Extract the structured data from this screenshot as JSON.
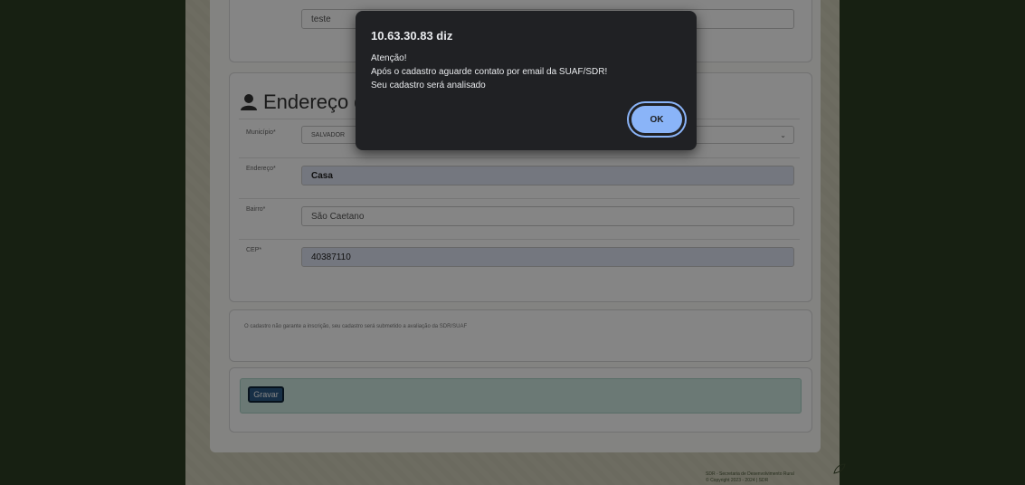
{
  "form": {
    "previous_field_value": "teste",
    "section_title": "Endereço do",
    "municipio": {
      "label": "Município*",
      "value": "SALVADOR"
    },
    "endereco": {
      "label": "Endereço*",
      "value": "Casa"
    },
    "bairro": {
      "label": "Bairro*",
      "value": "São Caetano"
    },
    "cep": {
      "label": "CEP*",
      "value": "40387110"
    },
    "notice": "O cadastro não garante a inscrição, seu cadastro será submetido a avaliação da SDR/SUAF",
    "save_label": "Gravar"
  },
  "footer": {
    "line1": "SDR - Secretaria de Desenvolvimento Rural",
    "line2": "© Copyright 2023 - 2024 | SDR"
  },
  "dialog": {
    "title": "10.63.30.83 diz",
    "message": "Atenção!\nApós o cadastro aguarde contato por email da SUAF/SDR!\nSeu cadastro será analisado",
    "ok_label": "OK"
  }
}
